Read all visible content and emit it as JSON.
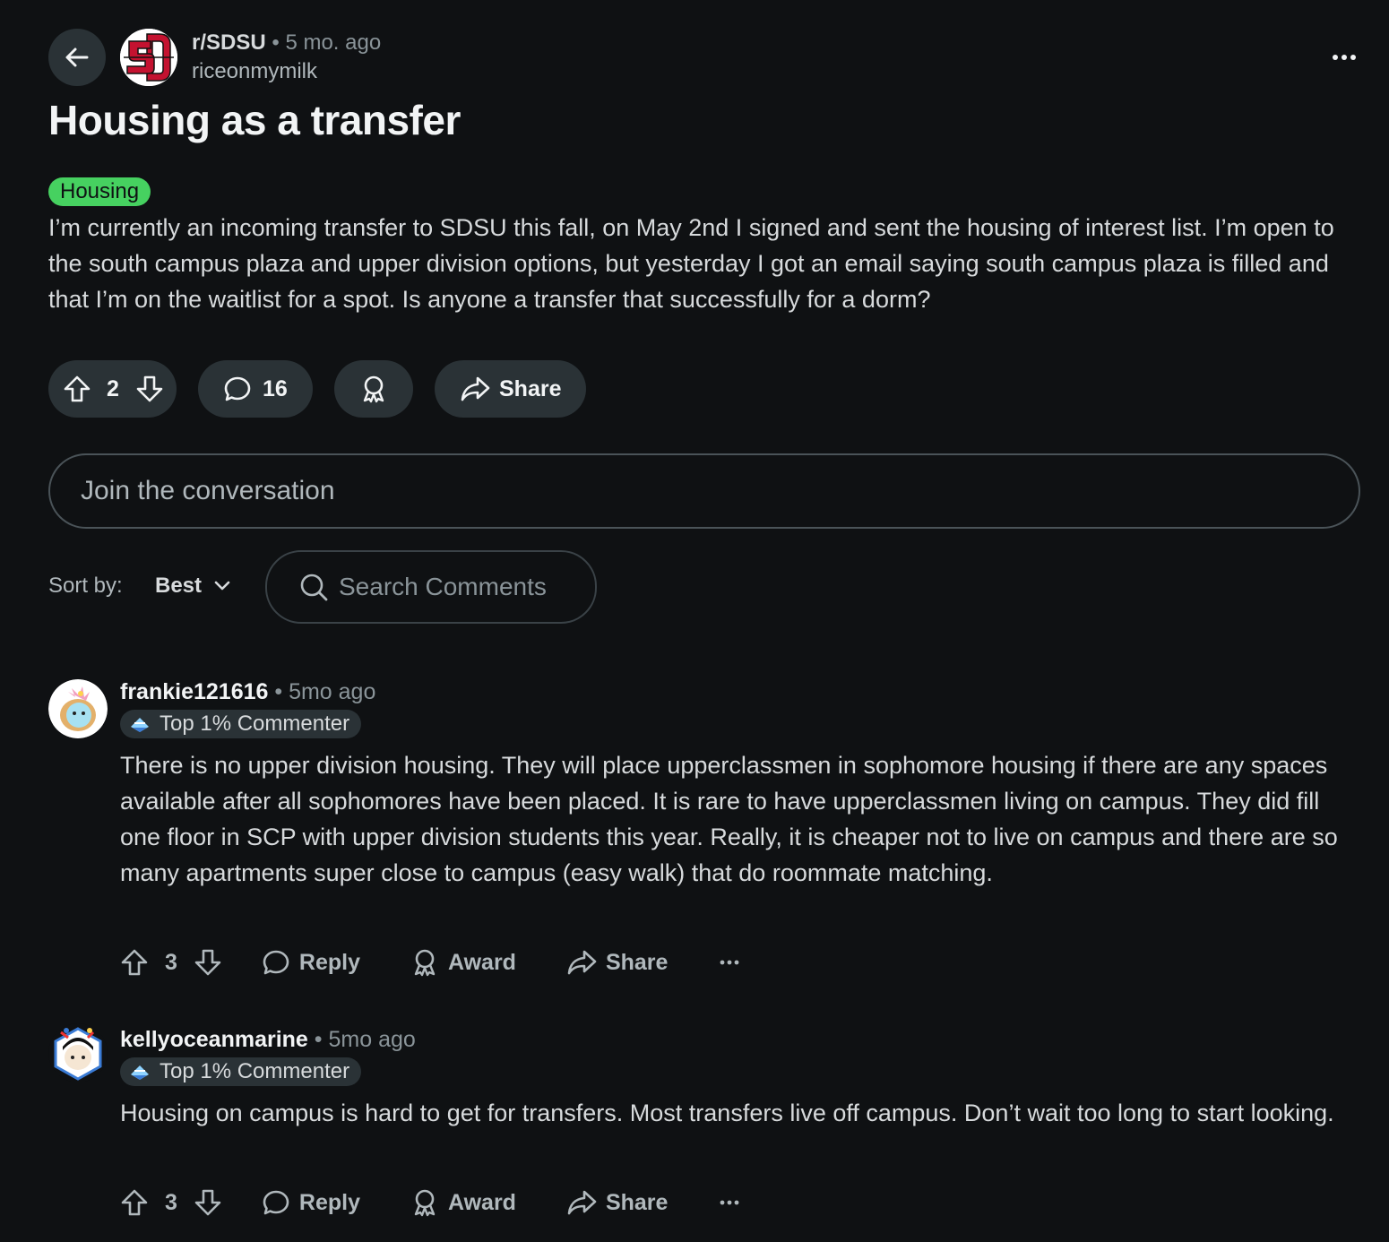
{
  "header": {
    "subreddit": "r/SDSU",
    "separator": "•",
    "age": "5 mo. ago",
    "author": "riceonmymilk"
  },
  "post": {
    "title": "Housing as a transfer",
    "flair": "Housing",
    "flair_color": "#46d160",
    "body": "I’m currently an incoming transfer to SDSU this fall, on May 2nd I signed and sent the housing of interest list. I’m open to the south campus plaza and upper division options, but yesterday I got an email saying south campus plaza is filled and that I’m on the waitlist for a spot. Is anyone a transfer that successfully for a dorm?",
    "votes": "2",
    "comments": "16",
    "share_label": "Share"
  },
  "composer": {
    "placeholder": "Join the conversation"
  },
  "sort": {
    "label": "Sort by:",
    "value": "Best"
  },
  "search": {
    "placeholder": "Search Comments"
  },
  "comments": [
    {
      "user": "frankie121616",
      "separator": "•",
      "age": "5mo ago",
      "badge": "Top 1% Commenter",
      "body": "There is no upper division housing. They will place upperclassmen in sophomore housing if there are any spaces available after all sophomores have been placed. It is rare to have upperclassmen living on campus. They did fill one floor in SCP with upper division students this year. Really, it is cheaper not to live on campus and there are so many apartments super close to campus (easy walk) that do roommate matching.",
      "votes": "3",
      "reply": "Reply",
      "award": "Award",
      "share": "Share"
    },
    {
      "user": "kellyoceanmarine",
      "separator": "•",
      "age": "5mo ago",
      "badge": "Top 1% Commenter",
      "body": "Housing on campus is hard to get for transfers. Most transfers live off campus. Don’t wait too long to start looking.",
      "votes": "3",
      "reply": "Reply",
      "award": "Award",
      "share": "Share"
    }
  ],
  "colors": {
    "background": "#0f1113",
    "pill": "#2a3236",
    "brand_red": "#c41230"
  }
}
